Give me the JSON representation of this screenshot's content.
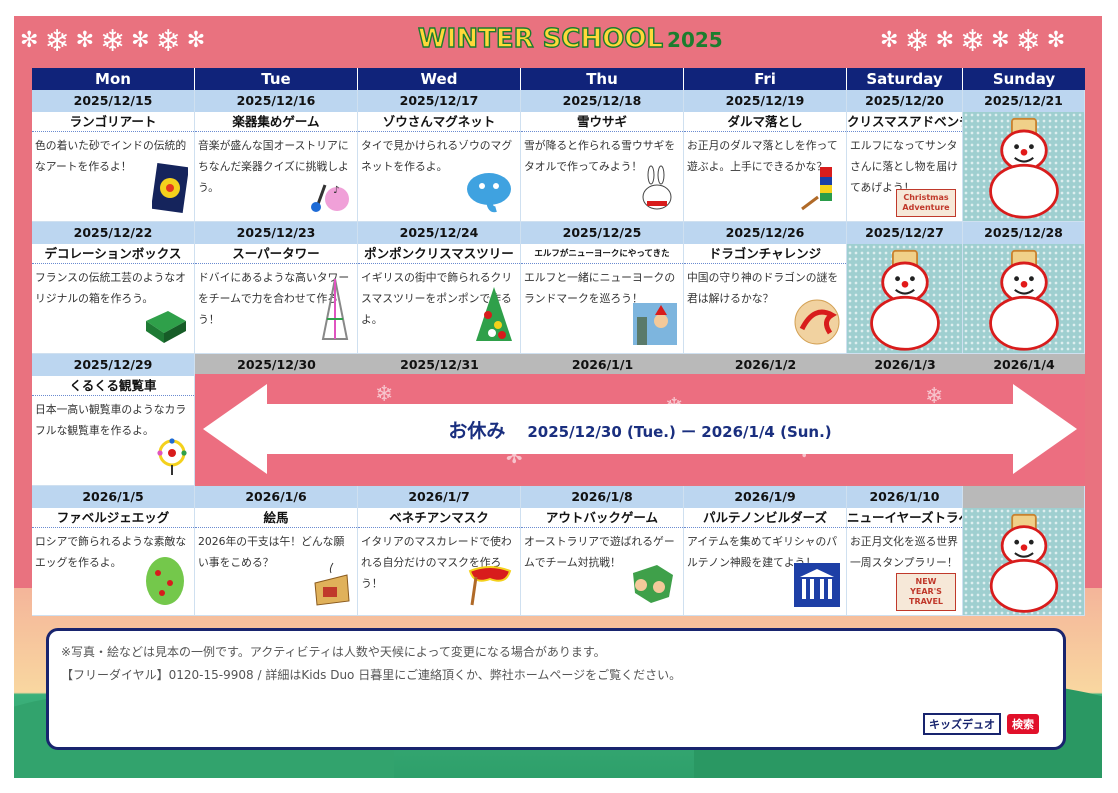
{
  "title": {
    "main": "WINTER SCHOOL",
    "year": "2025"
  },
  "weekdays": [
    "Mon",
    "Tue",
    "Wed",
    "Thu",
    "Fri",
    "Saturday",
    "Sunday"
  ],
  "week1": [
    {
      "date": "2025/12/15",
      "activity": "ランゴリアート",
      "desc": "色の着いた砂でインドの伝統的なアートを作るよ！"
    },
    {
      "date": "2025/12/16",
      "activity": "楽器集めゲーム",
      "desc": "音楽が盛んな国オーストリアにちなんだ楽器クイズに挑戦しよう。"
    },
    {
      "date": "2025/12/17",
      "activity": "ゾウさんマグネット",
      "desc": "タイで見かけられるゾウのマグネットを作るよ。"
    },
    {
      "date": "2025/12/18",
      "activity": "雪ウサギ",
      "desc": "雪が降ると作られる雪ウサギをタオルで作ってみよう！"
    },
    {
      "date": "2025/12/19",
      "activity": "ダルマ落とし",
      "desc": "お正月のダルマ落としを作って遊ぶよ。上手にできるかな？"
    },
    {
      "date": "2025/12/20",
      "activity": "クリスマスアドベンチャー",
      "desc": "エルフになってサンタさんに落とし物を届けてあげよう！",
      "pic_label": "Christmas Adventure"
    },
    {
      "date": "2025/12/21"
    }
  ],
  "week2": [
    {
      "date": "2025/12/22",
      "activity": "デコレーションボックス",
      "desc": "フランスの伝統工芸のようなオリジナルの箱を作ろう。"
    },
    {
      "date": "2025/12/23",
      "activity": "スーパータワー",
      "desc": "ドバイにあるような高いタワーをチームで力を合わせて作ろう！"
    },
    {
      "date": "2025/12/24",
      "activity": "ポンポンクリスマスツリー",
      "desc": "イギリスの街中で飾られるクリスマスツリーをポンポンで作るよ。"
    },
    {
      "date": "2025/12/25",
      "activity": "エルフがニューヨークにやってきた",
      "desc": "エルフと一緒にニューヨークのランドマークを巡ろう！"
    },
    {
      "date": "2025/12/26",
      "activity": "ドラゴンチャレンジ",
      "desc": "中国の守り神のドラゴンの謎を君は解けるかな？"
    },
    {
      "date": "2025/12/27"
    },
    {
      "date": "2025/12/28"
    }
  ],
  "week3": [
    {
      "date": "2025/12/29",
      "activity": "くるくる観覧車",
      "desc": "日本一高い観覧車のようなカラフルな観覧車を作るよ。"
    },
    {
      "date": "2025/12/30"
    },
    {
      "date": "2025/12/31"
    },
    {
      "date": "2026/1/1"
    },
    {
      "date": "2026/1/2"
    },
    {
      "date": "2026/1/3"
    },
    {
      "date": "2026/1/4"
    }
  ],
  "holiday": {
    "label": "お休み",
    "range": "2025/12/30 (Tue.) ー 2026/1/4 (Sun.)"
  },
  "week4": [
    {
      "date": "2026/1/5",
      "activity": "ファベルジェエッグ",
      "desc": "ロシアで飾られるような素敵なエッグを作るよ。"
    },
    {
      "date": "2026/1/6",
      "activity": "絵馬",
      "desc": "2026年の干支は午！どんな願い事をこめる？"
    },
    {
      "date": "2026/1/7",
      "activity": "ベネチアンマスク",
      "desc": "イタリアのマスカレードで使われる自分だけのマスクを作ろう！"
    },
    {
      "date": "2026/1/8",
      "activity": "アウトバックゲーム",
      "desc": "オーストラリアで遊ばれるゲームでチーム対抗戦！"
    },
    {
      "date": "2026/1/9",
      "activity": "パルテノンビルダーズ",
      "desc": "アイテムを集めてギリシャのパルテノン神殿を建てよう！"
    },
    {
      "date": "2026/1/10",
      "activity": "ニューイヤーズトラベル",
      "desc": "お正月文化を巡る世界一周スタンプラリー！",
      "pic_label": "NEW YEAR'S TRAVEL"
    },
    {
      "date": ""
    }
  ],
  "notes": {
    "line1": "※写真・絵などは見本の一例です。アクティビティは人数や天候によって変更になる場合があります。",
    "line2": "【フリーダイヤル】0120-15-9908 / 詳細はKids Duo 日暮里にご連絡頂くか、弊社ホームページをご覧ください。",
    "search_term": "キッズデュオ",
    "search_button": "検索"
  },
  "colors": {
    "frame": "#e9727f",
    "header": "#10237a",
    "date_bg": "#bcd6f0",
    "holiday_text": "#1a2f7f",
    "search_red": "#e1102a"
  }
}
